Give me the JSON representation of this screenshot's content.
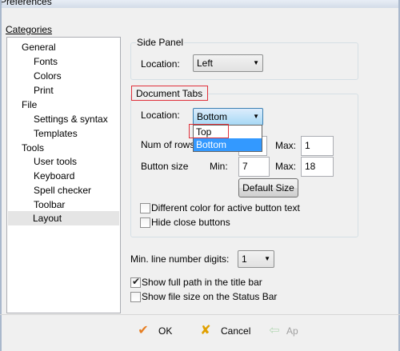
{
  "window": {
    "title": "Preferences"
  },
  "categories": {
    "label": "Categories",
    "items": [
      {
        "label": "General",
        "level": 0
      },
      {
        "label": "Fonts",
        "level": 1
      },
      {
        "label": "Colors",
        "level": 1
      },
      {
        "label": "Print",
        "level": 1
      },
      {
        "label": "File",
        "level": 0
      },
      {
        "label": "Settings & syntax",
        "level": 1
      },
      {
        "label": "Templates",
        "level": 1
      },
      {
        "label": "Tools",
        "level": 0
      },
      {
        "label": "User tools",
        "level": 1
      },
      {
        "label": "Keyboard",
        "level": 1
      },
      {
        "label": "Spell checker",
        "level": 1
      },
      {
        "label": "Toolbar",
        "level": 1
      },
      {
        "label": "Layout",
        "level": 1,
        "selected": true
      }
    ]
  },
  "side_panel": {
    "title": "Side Panel",
    "location_label": "Location:",
    "location_value": "Left"
  },
  "document_tabs": {
    "title": "Document Tabs",
    "location_label": "Location:",
    "location_value": "Bottom",
    "location_options": [
      "Top",
      "Bottom"
    ],
    "highlighted_option": "Bottom",
    "num_rows_label": "Num of rows",
    "max_label": "Max:",
    "rows_max": "1",
    "button_size_label": "Button size",
    "min_label": "Min:",
    "button_min": "7",
    "button_max": "18",
    "default_size_label": "Default Size",
    "different_color_label": "Different color for active button text",
    "different_color_checked": false,
    "hide_close_label": "Hide close buttons",
    "hide_close_checked": false
  },
  "min_line_digits": {
    "label": "Min. line number digits:",
    "value": "1"
  },
  "show_full_path": {
    "label": "Show full path in the title bar",
    "checked": true
  },
  "show_file_size": {
    "label": "Show file size on the Status Bar",
    "checked": false
  },
  "buttons": {
    "ok": "OK",
    "cancel": "Cancel",
    "apply": "Ap"
  },
  "colors": {
    "highlight": "#3399ff",
    "annotation": "#e0303a",
    "ok_icon": "#e67e22",
    "cancel_icon": "#e0a000"
  }
}
